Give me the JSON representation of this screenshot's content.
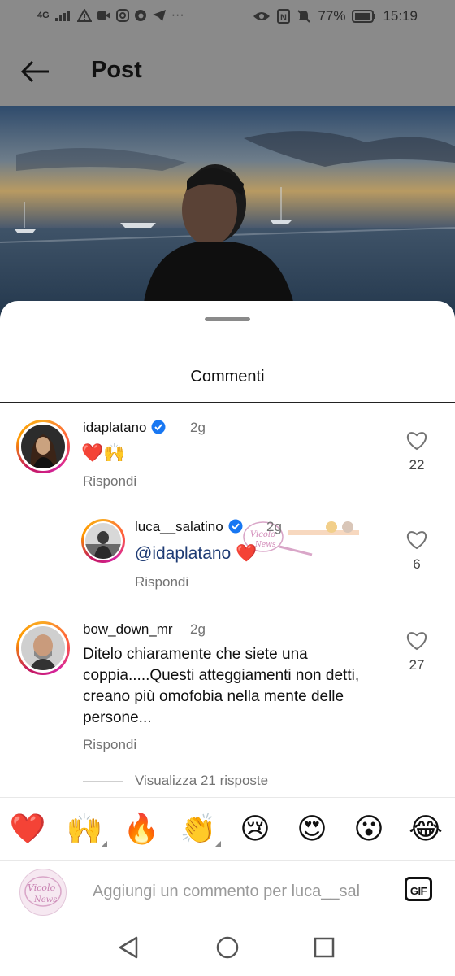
{
  "status_bar": {
    "network": "4G",
    "battery": "77%",
    "time": "15:19",
    "more": "···"
  },
  "header": {
    "title": "Post"
  },
  "sheet": {
    "title": "Commenti"
  },
  "comments": [
    {
      "username": "idaplatano",
      "verified": true,
      "time": "2g",
      "text": "❤️🙌",
      "reply_label": "Rispondi",
      "likes": "22"
    },
    {
      "username": "luca__salatino",
      "verified": true,
      "time": "2g",
      "mention": "@idaplatano",
      "text": "❤️",
      "reply_label": "Rispondi",
      "likes": "6"
    },
    {
      "username": "bow_down_mr",
      "verified": false,
      "time": "2g",
      "text": "Ditelo chiaramente che siete una coppia.....Questi atteggiamenti non detti, creano più omofobia nella mente delle persone...",
      "reply_label": "Rispondi",
      "likes": "27"
    }
  ],
  "view_replies": "Visualizza 21 risposte",
  "emoji_bar": [
    "❤️",
    "🙌",
    "🔥",
    "👏",
    "😢",
    "😍",
    "😮",
    "😂"
  ],
  "composer": {
    "placeholder": "Aggiungi un commento per luca__sal",
    "gif_label": "GIF"
  },
  "colors": {
    "verified": "#1877f2",
    "heart": "#e0245e",
    "mention": "#1d3a73",
    "secondary_text": "#737373"
  }
}
